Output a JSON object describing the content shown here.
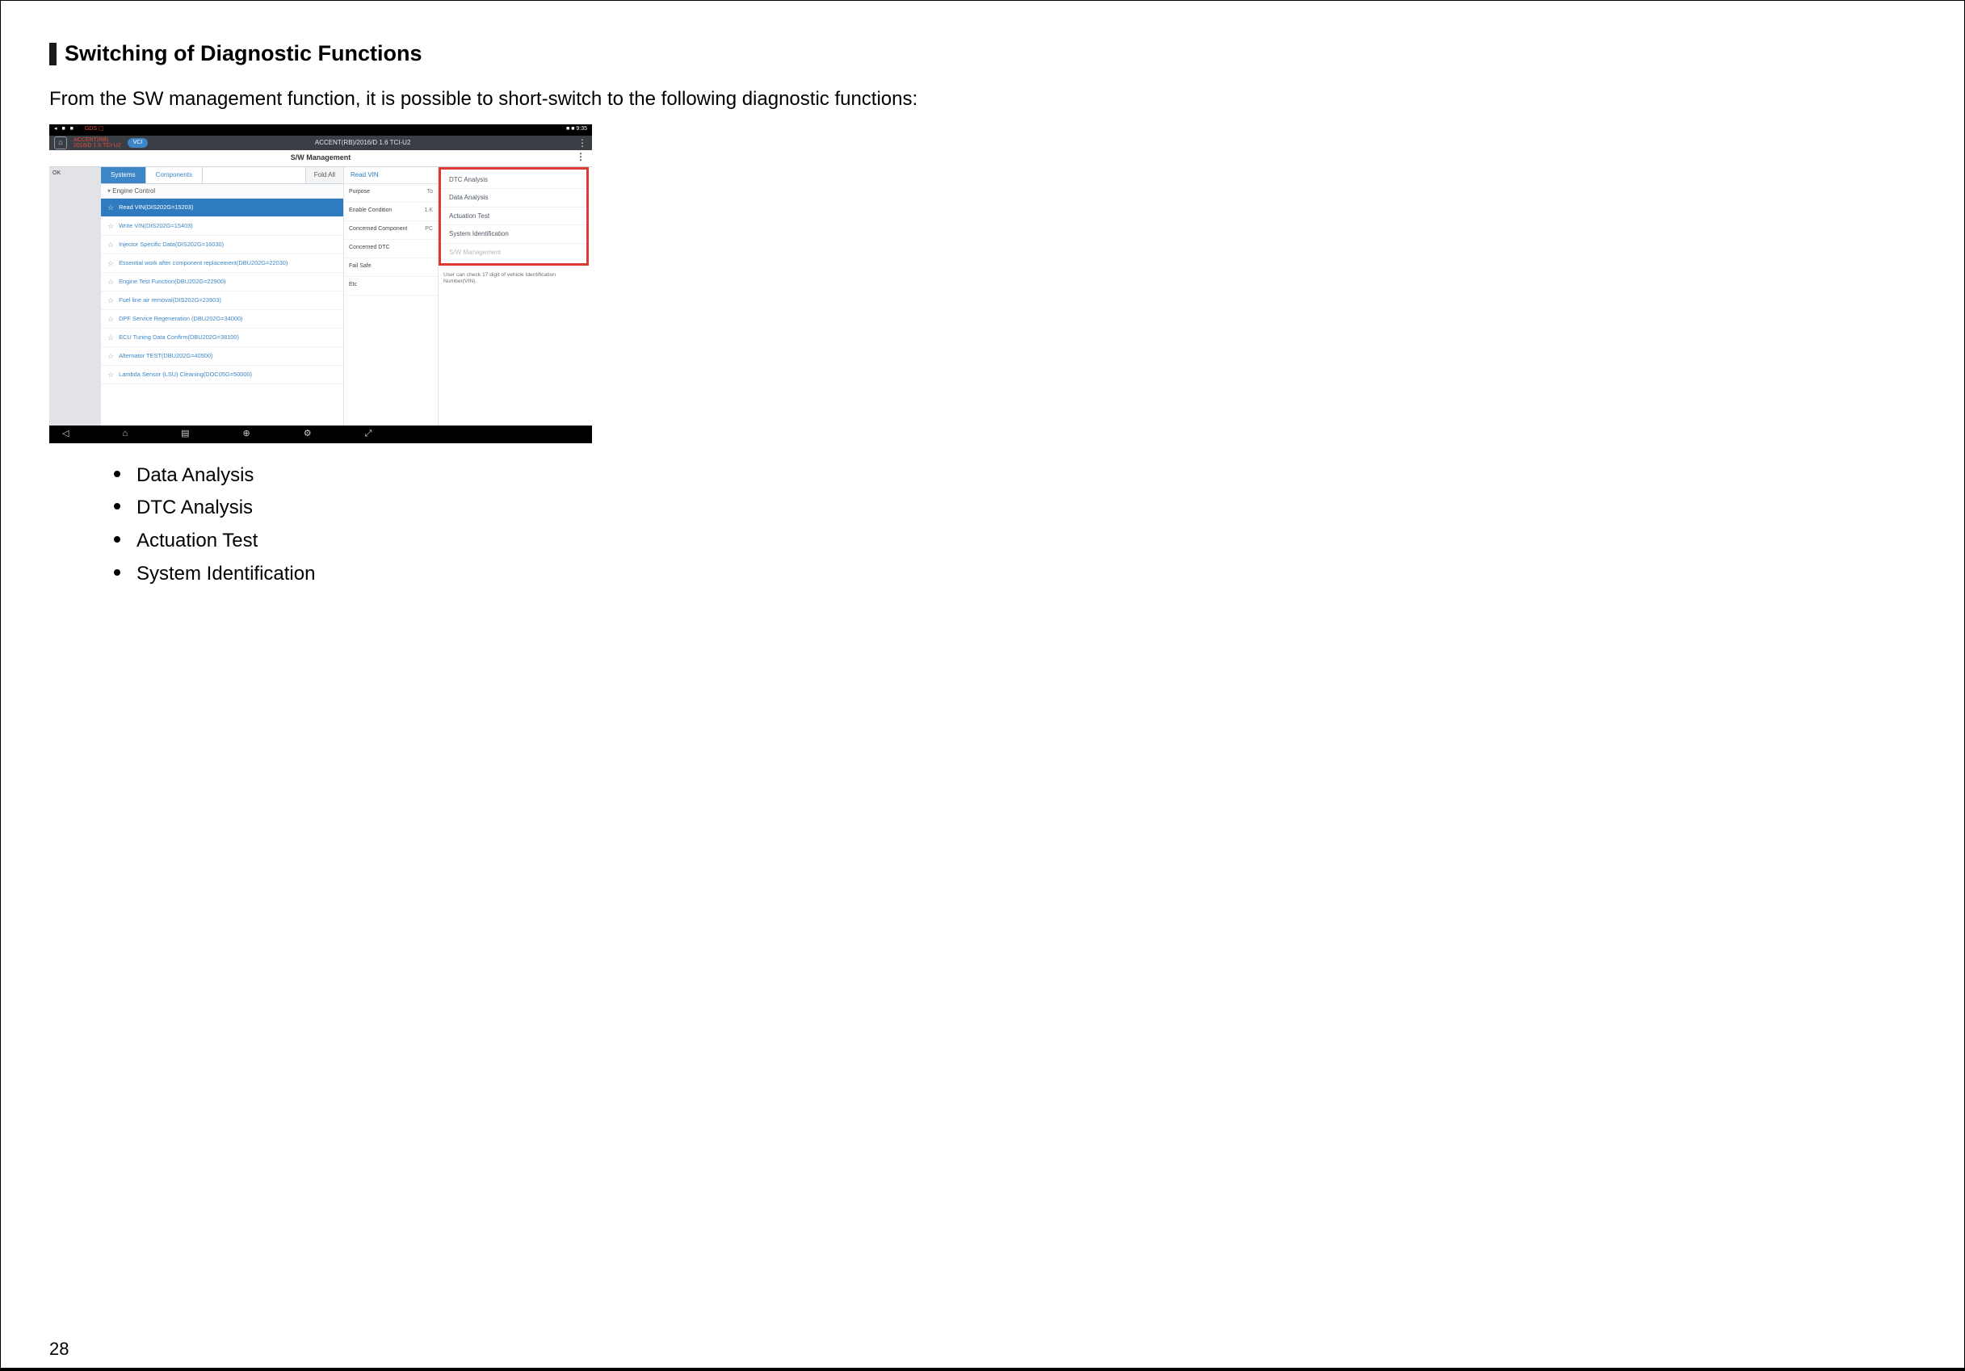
{
  "page_number": "28",
  "section_title": "Switching of Diagnostic Functions",
  "intro_text": "From the SW management function, it is possible to short-switch to the following diagnostic functions:",
  "bullet_items": [
    "Data Analysis",
    "DTC Analysis",
    "Actuation Test",
    "System Identification"
  ],
  "shot": {
    "status": {
      "left_icons": [
        "◂",
        "■",
        "■"
      ],
      "right_text": "■  ■ 9:35",
      "red_text": "GDS ▢"
    },
    "titlebar": {
      "home": "⌂",
      "red_line1": "ACCENT(RB)",
      "red_line2": "2016/D 1.6 TCI-U2",
      "vci_badge": "VCI",
      "vehicle": "ACCENT(RB)/2016/D 1.6 TCI-U2",
      "dots": "⋮"
    },
    "sw_title": "S/W Management",
    "ok_label": "OK",
    "tabs": {
      "systems": "Systems",
      "components": "Components",
      "fold": "Fold All"
    },
    "group": "Engine Control",
    "list": [
      {
        "label": "Read VIN(DIS202G=15203)",
        "selected": true
      },
      {
        "label": "Write VIN(DIS202G=15403)"
      },
      {
        "label": "Injector Specific Data(DIS202G=16030)"
      },
      {
        "label": "Essential work after component replacement(DBU202G=22030)"
      },
      {
        "label": "Engine Test Function(DBU202G=22900)"
      },
      {
        "label": "Fuel line air removal(DIS202G=23903)"
      },
      {
        "label": "DPF Service Regeneration (DBU202G=34000)"
      },
      {
        "label": "ECU Tuning Data Confirm(DBU202G=38100)"
      },
      {
        "label": "Alternator TEST(DBU202G=40500)"
      },
      {
        "label": "Lambda Sensor (LSU) Cleaning(DOC05G=50000)"
      }
    ],
    "detail_header": "Read VIN",
    "detail_rows": [
      {
        "k": "Purpose",
        "v": "To"
      },
      {
        "k": "Enable Condition",
        "v": "1.K"
      },
      {
        "k": "Concerned Component",
        "v": "PC"
      },
      {
        "k": "Concerned DTC",
        "v": ""
      },
      {
        "k": "Fail Safe",
        "v": ""
      },
      {
        "k": "Etc",
        "v": ""
      }
    ],
    "menu_items": [
      "DTC Analysis",
      "Data Analysis",
      "Actuation Test",
      "System Identification",
      "S/W Management"
    ],
    "help_text": "User can check 17 digit of vehicle Identification Number(VIN).",
    "navbar": [
      "◁",
      "⌂",
      "▤",
      "⊕",
      "⚙",
      "⤢"
    ]
  }
}
